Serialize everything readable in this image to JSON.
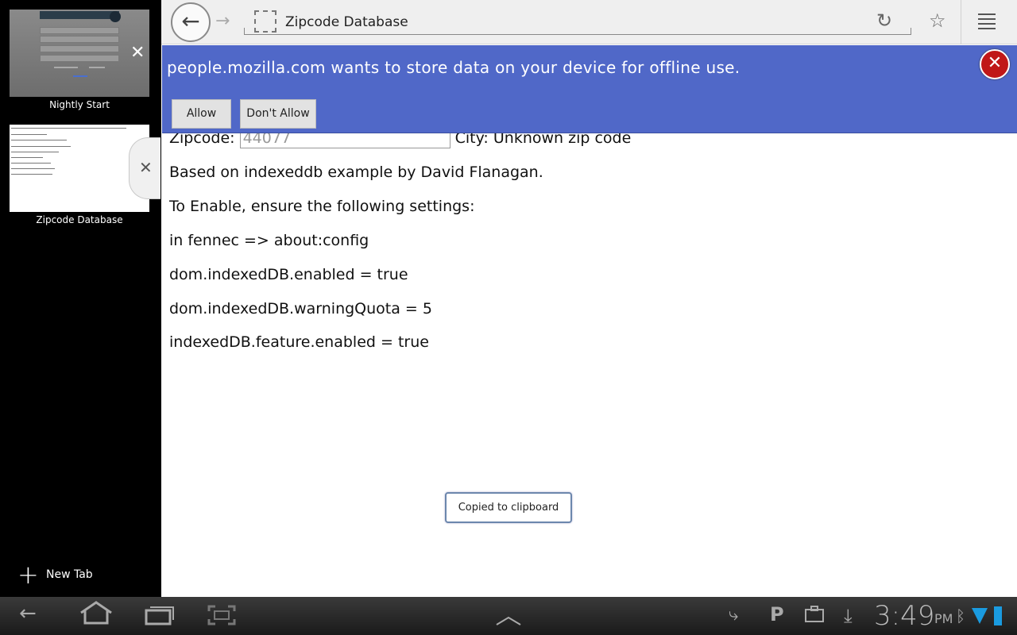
{
  "tabs_tray": {
    "tabs": [
      {
        "label": "Nightly Start"
      },
      {
        "label": "Zipcode Database"
      }
    ],
    "close_glyph": "✕",
    "new_tab_label": "New Tab"
  },
  "toolbar": {
    "page_title": "Zipcode Database"
  },
  "doorhanger": {
    "message": "people.mozilla.com wants to store data on your device for offline use.",
    "allow_label": "Allow",
    "deny_label": "Don't Allow",
    "close_glyph": "✕",
    "background_color": "#5068c8"
  },
  "page": {
    "zip_label": "Zipcode:",
    "zip_value": "44077",
    "city_text": "City: Unknown zip code",
    "lines": [
      "Based on indexeddb example by David Flanagan.",
      "To Enable, ensure the following settings:",
      "in fennec => about:config",
      "dom.indexedDB.enabled = true",
      "dom.indexedDB.warningQuota = 5",
      "indexedDB.feature.enabled = true"
    ]
  },
  "toast": {
    "text": "Copied to clipboard"
  },
  "system_bar": {
    "time": "3:49",
    "ampm": "PM"
  }
}
